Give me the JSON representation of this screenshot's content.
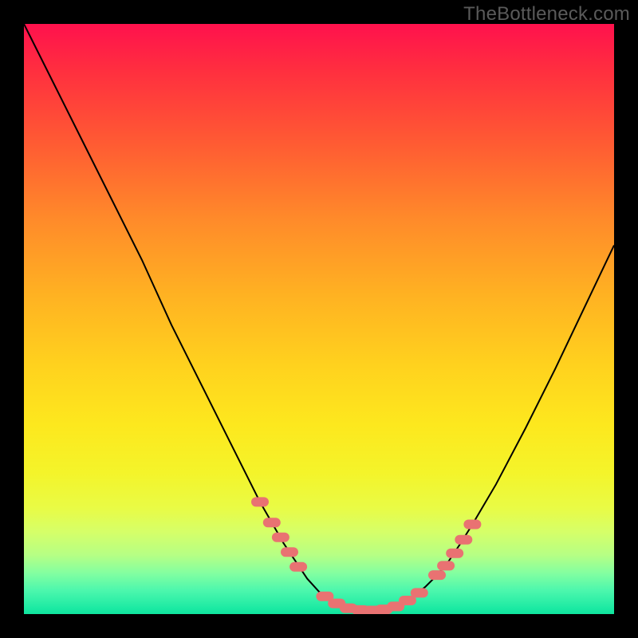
{
  "watermark": "TheBottleneck.com",
  "colors": {
    "background": "#000000",
    "curve": "#000000",
    "marker": "#e97272",
    "gradient_top": "#ff114d",
    "gradient_bottom": "#10e49e"
  },
  "chart_data": {
    "type": "line",
    "title": "",
    "xlabel": "",
    "ylabel": "",
    "xlim": [
      0,
      100
    ],
    "ylim": [
      0,
      100
    ],
    "minimum_x_range": [
      51,
      65
    ],
    "curve": [
      {
        "x": 0,
        "y": 100
      },
      {
        "x": 5,
        "y": 90
      },
      {
        "x": 10,
        "y": 80
      },
      {
        "x": 15,
        "y": 70
      },
      {
        "x": 20,
        "y": 60
      },
      {
        "x": 25,
        "y": 49
      },
      {
        "x": 30,
        "y": 39
      },
      {
        "x": 35,
        "y": 29
      },
      {
        "x": 38,
        "y": 23
      },
      {
        "x": 40,
        "y": 19
      },
      {
        "x": 42,
        "y": 15.5
      },
      {
        "x": 44,
        "y": 12
      },
      {
        "x": 46,
        "y": 9
      },
      {
        "x": 48,
        "y": 6
      },
      {
        "x": 50,
        "y": 3.8
      },
      {
        "x": 52,
        "y": 2.2
      },
      {
        "x": 54,
        "y": 1.2
      },
      {
        "x": 56,
        "y": 0.7
      },
      {
        "x": 58,
        "y": 0.5
      },
      {
        "x": 60,
        "y": 0.6
      },
      {
        "x": 62,
        "y": 1.0
      },
      {
        "x": 64,
        "y": 1.8
      },
      {
        "x": 66,
        "y": 3.0
      },
      {
        "x": 68,
        "y": 4.6
      },
      {
        "x": 70,
        "y": 6.6
      },
      {
        "x": 72,
        "y": 9.0
      },
      {
        "x": 74,
        "y": 12.0
      },
      {
        "x": 76,
        "y": 15.2
      },
      {
        "x": 80,
        "y": 22.0
      },
      {
        "x": 85,
        "y": 31.5
      },
      {
        "x": 90,
        "y": 41.5
      },
      {
        "x": 95,
        "y": 52.0
      },
      {
        "x": 100,
        "y": 62.5
      }
    ],
    "markers": [
      {
        "x": 40,
        "y": 19
      },
      {
        "x": 42,
        "y": 15.5
      },
      {
        "x": 43.5,
        "y": 13
      },
      {
        "x": 45,
        "y": 10.5
      },
      {
        "x": 46.5,
        "y": 8
      },
      {
        "x": 51,
        "y": 3
      },
      {
        "x": 53,
        "y": 1.8
      },
      {
        "x": 55,
        "y": 1
      },
      {
        "x": 57,
        "y": 0.7
      },
      {
        "x": 59,
        "y": 0.6
      },
      {
        "x": 61,
        "y": 0.8
      },
      {
        "x": 63,
        "y": 1.3
      },
      {
        "x": 65,
        "y": 2.3
      },
      {
        "x": 67,
        "y": 3.6
      },
      {
        "x": 70,
        "y": 6.6
      },
      {
        "x": 71.5,
        "y": 8.2
      },
      {
        "x": 73,
        "y": 10.3
      },
      {
        "x": 74.5,
        "y": 12.6
      },
      {
        "x": 76,
        "y": 15.2
      }
    ]
  }
}
